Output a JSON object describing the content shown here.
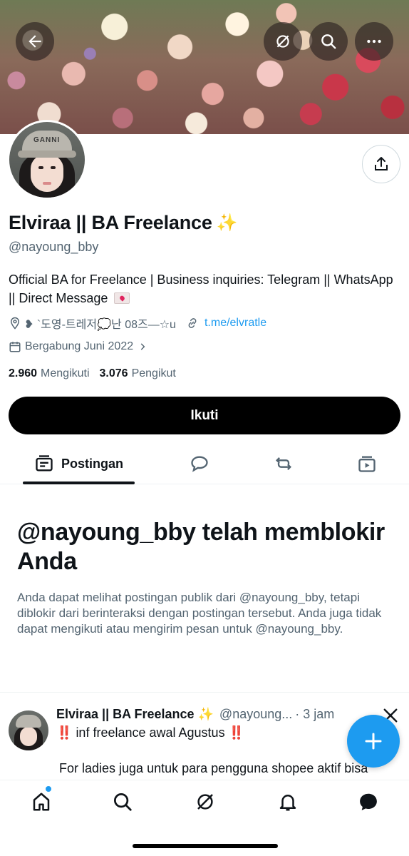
{
  "profile": {
    "name": "Elviraa || BA Freelance",
    "name_emoji": "✨",
    "handle": "@nayoung_bby",
    "bio": "Official BA for Freelance | Business inquiries: Telegram || WhatsApp || Direct Message",
    "location": "❥ `도영-트레저💭난 08즈—☆u",
    "link": "t.me/elvratle",
    "joined": "Bergabung Juni 2022",
    "following_count": "2.960",
    "following_label": "Mengikuti",
    "followers_count": "3.076",
    "followers_label": "Pengikut",
    "avatar_hat_text": "GANNI"
  },
  "actions": {
    "follow_label": "Ikuti"
  },
  "header_icons": [
    "back-arrow-icon",
    "grok-icon",
    "search-icon",
    "more-icon"
  ],
  "tabs": [
    {
      "label": "Postingan",
      "icon": "posts-icon",
      "selected": true
    },
    {
      "label": "",
      "icon": "replies-icon",
      "selected": false
    },
    {
      "label": "",
      "icon": "reposts-icon",
      "selected": false
    },
    {
      "label": "",
      "icon": "media-icon",
      "selected": false
    }
  ],
  "blocked": {
    "title": "@nayoung_bby telah memblokir Anda",
    "description": "Anda dapat melihat postingan publik dari @nayoung_bby, tetapi diblokir dari berinteraksi dengan postingan tersebut. Anda juga tidak dapat mengikuti atau mengirim pesan untuk @nayoung_bby."
  },
  "post": {
    "author_name": "Elviraa || BA Freelance",
    "author_emoji": "✨",
    "author_handle": "@nayoung...",
    "time": "· 3 jam",
    "excl": "‼️",
    "line1": "inf freelance awal Agustus",
    "line2": "For ladies juga untuk para pengguna shopee aktif bisa"
  },
  "bottom_nav": [
    "home-icon",
    "search-icon",
    "grok-icon",
    "notifications-icon",
    "messages-icon"
  ],
  "colors": {
    "accent": "#1d9bf0",
    "text_primary": "#0f1419",
    "text_secondary": "#536471"
  }
}
